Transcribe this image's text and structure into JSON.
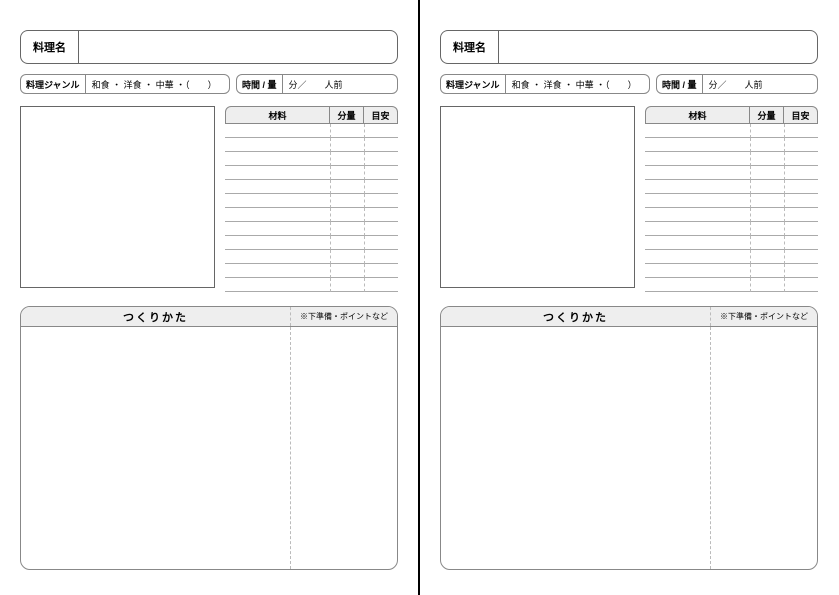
{
  "name_label": "料理名",
  "genre_label": "料理ジャンル",
  "genre_options": "和食 ・ 洋食 ・ 中華 ・（　　）",
  "time_label": "時間 / 量",
  "time_body": "分／　　人前",
  "ing_head_material": "材料",
  "ing_head_qty": "分量",
  "ing_head_est": "目安",
  "ing_row_count": 12,
  "method_title": "つくりかた",
  "method_tips": "※下準備・ポイントなど"
}
